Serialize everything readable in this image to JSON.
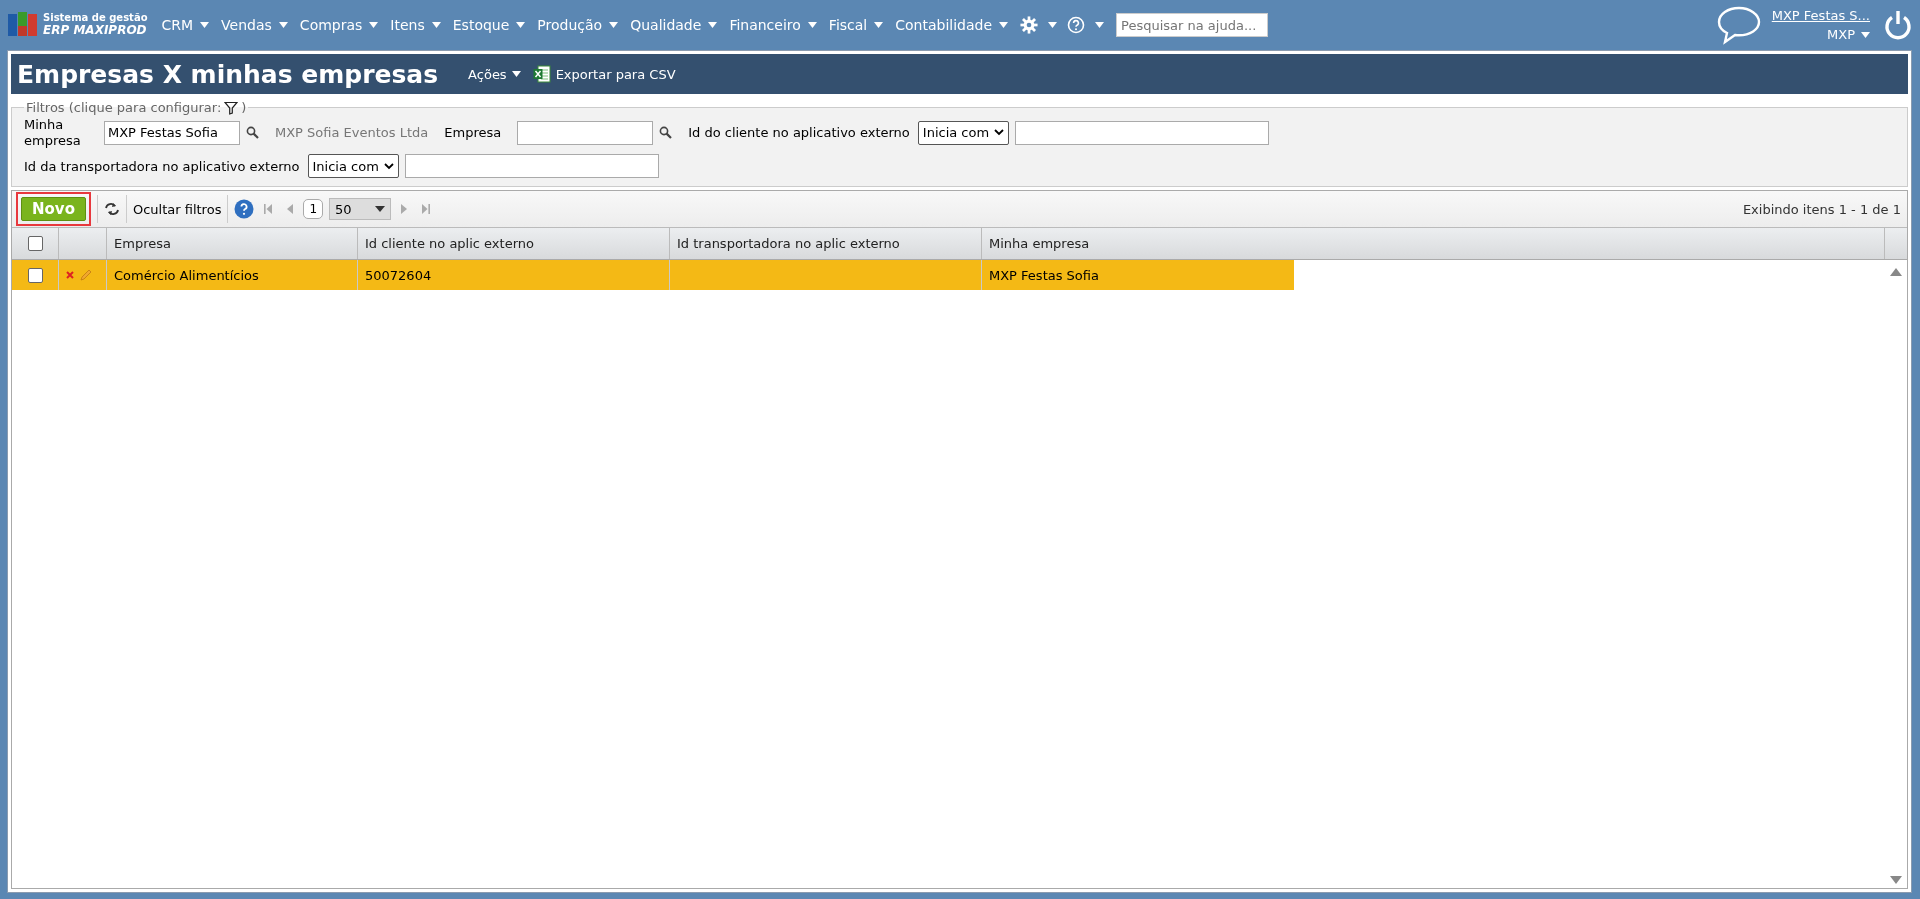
{
  "brand": {
    "line1": "Sistema de gestão",
    "line2": "ERP MAXIPROD"
  },
  "menu": [
    {
      "label": "CRM",
      "kind": "text"
    },
    {
      "label": "Vendas",
      "kind": "text"
    },
    {
      "label": "Compras",
      "kind": "text"
    },
    {
      "label": "Itens",
      "kind": "text"
    },
    {
      "label": "Estoque",
      "kind": "text"
    },
    {
      "label": "Produção",
      "kind": "text"
    },
    {
      "label": "Qualidade",
      "kind": "text"
    },
    {
      "label": "Financeiro",
      "kind": "text"
    },
    {
      "label": "Fiscal",
      "kind": "text"
    },
    {
      "label": "Contabilidade",
      "kind": "text"
    },
    {
      "kind": "gear"
    },
    {
      "kind": "help"
    }
  ],
  "help_search": {
    "placeholder": "Pesquisar na ajuda..."
  },
  "user": {
    "name": "MXP Festas S...",
    "company": "MXP"
  },
  "page": {
    "title": "Empresas X minhas empresas",
    "actions": "Ações",
    "export": "Exportar para CSV"
  },
  "filters": {
    "legend_before": "Filtros (clique para configurar:",
    "legend_after": ")",
    "my_company_label": "Minha empresa",
    "my_company_value": "MXP Festas Sofia",
    "my_company_name": "MXP Sofia Eventos Ltda",
    "company_label": "Empresa",
    "client_id_label": "Id do cliente no aplicativo externo",
    "client_id_mode": "Inicia com",
    "carrier_id_label": "Id da transportadora no aplicativo externo",
    "carrier_id_mode": "Inicia com"
  },
  "toolbar": {
    "new_button": "Novo",
    "new_highlighted": true,
    "hide_filters": "Ocultar filtros",
    "page": "1",
    "page_size": "50",
    "summary": "Exibindo itens 1 - 1 de 1"
  },
  "table": {
    "header_checked": false,
    "columns": [
      "Empresa",
      "Id cliente no aplic externo",
      "Id transportadora no aplic externo",
      "Minha empresa"
    ],
    "rows": [
      {
        "checked": false,
        "selected": true,
        "cells": [
          "Comércio Alimentícios",
          "50072604",
          "",
          "MXP Festas Sofia"
        ]
      }
    ]
  }
}
